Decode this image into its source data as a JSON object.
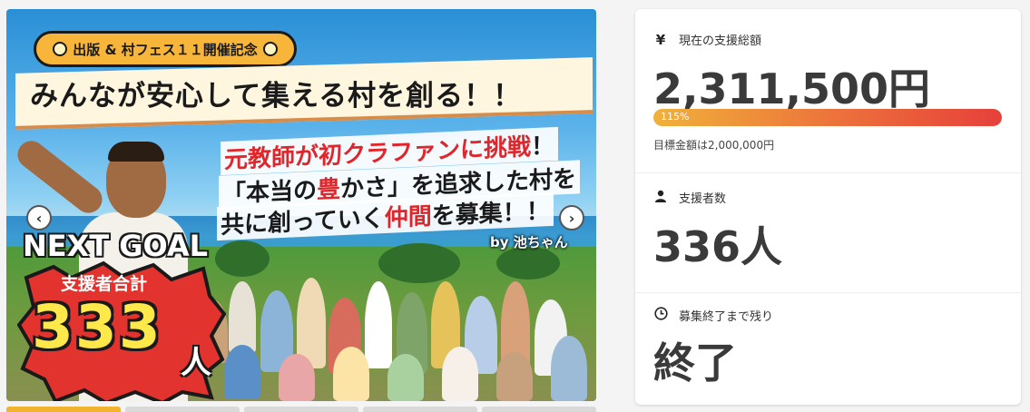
{
  "hero": {
    "banner_label": "出版 & 村フェス１１開催記念",
    "headline": "みんなが安心して集える村を創る！！",
    "line1_a": "元教師が初クラファンに",
    "line1_b": "挑戦",
    "line1_c": "！",
    "line2_a": "「本当の",
    "line2_b": "豊",
    "line2_c": "かさ」を追求した村を",
    "line3_a": "共に創っていく",
    "line3_b": "仲間",
    "line3_c": "を募集！！",
    "byline": "by 池ちゃん",
    "next_goal": "NEXT GOAL",
    "goal_sub": "支援者合計",
    "goal_number": "333",
    "goal_unit": "人",
    "prev_glyph": "‹",
    "next_glyph": "›"
  },
  "stats": {
    "total_label": "現在の支援総額",
    "total_icon": "yen-icon",
    "total_amount": "2,311,500円",
    "progress_percent": 115,
    "progress_label": "115%",
    "target_text": "目標金額は2,000,000円",
    "supporters_label": "支援者数",
    "supporters_icon": "person-icon",
    "supporters_count": "336人",
    "remaining_label": "募集終了まで残り",
    "remaining_icon": "clock-icon",
    "remaining_value": "終了"
  },
  "colors": {
    "accent": "#f2b42f",
    "progress_start": "#f0b13a",
    "progress_end": "#e6403a",
    "text_dark": "#3a3a3a"
  }
}
